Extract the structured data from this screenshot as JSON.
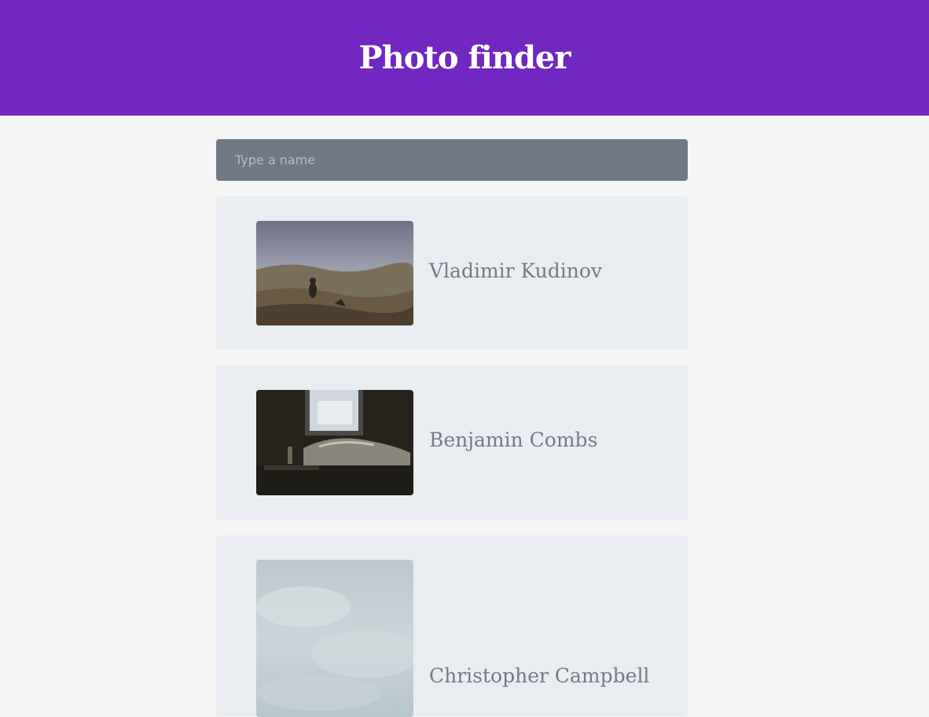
{
  "header": {
    "title": "Photo finder",
    "background_color": "#7127c1"
  },
  "search": {
    "placeholder": "Type a name",
    "value": ""
  },
  "photos": [
    {
      "name": "Vladimir Kudinov",
      "image": "mountain-landscape-photo"
    },
    {
      "name": "Benjamin Combs",
      "image": "dark-bedroom-window-photo"
    },
    {
      "name": "Christopher Campbell",
      "image": "pale-sky-photo"
    }
  ]
}
